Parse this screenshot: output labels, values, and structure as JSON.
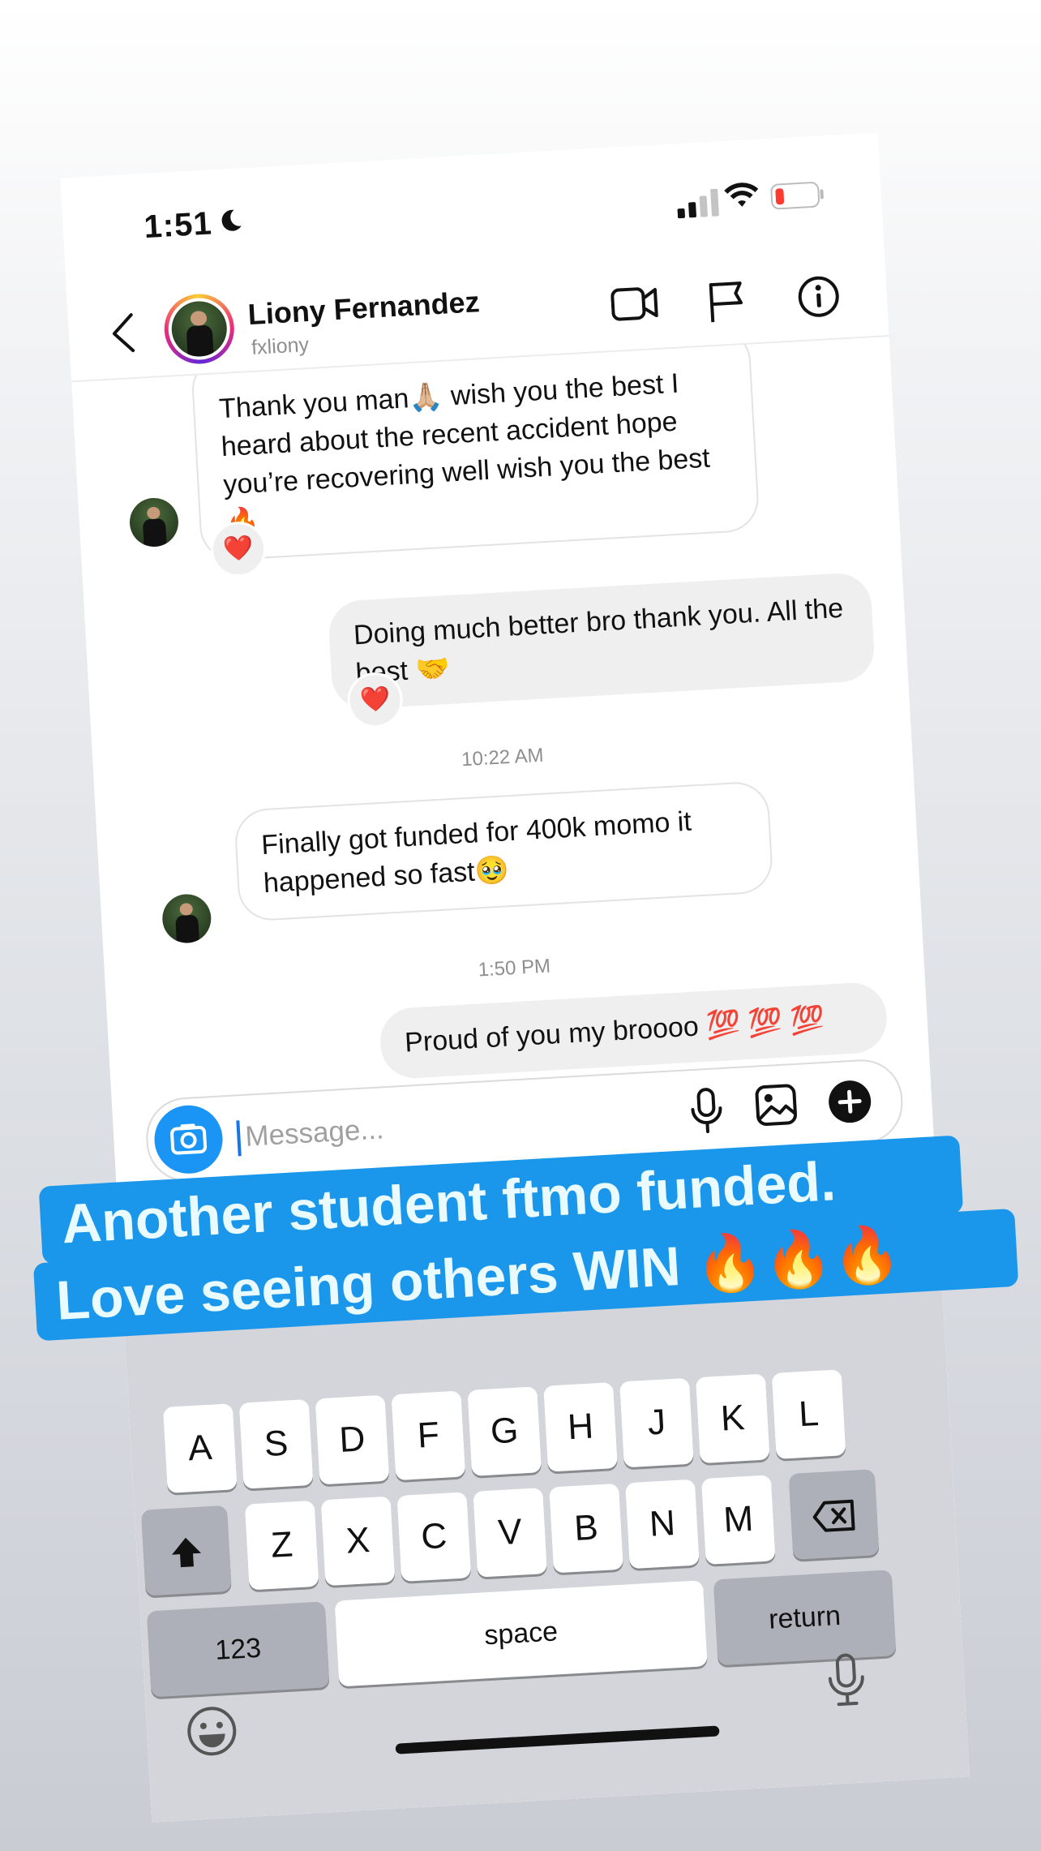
{
  "status": {
    "time": "1:51"
  },
  "header": {
    "name": "Liony Fernandez",
    "handle": "fxliony"
  },
  "messages": [
    {
      "side": "in",
      "text": "Thank you man🙏🏼 wish you the best I heard about the recent accident hope you’re recovering well wish you the best 🔥",
      "reaction": "❤️"
    },
    {
      "side": "out",
      "text": "Doing much better bro thank you. All the best 🤝",
      "reaction": "❤️"
    },
    {
      "timestamp": "10:22 AM"
    },
    {
      "side": "in",
      "text": "Finally got funded for 400k momo it happened so fast🥹"
    },
    {
      "timestamp": "1:50 PM"
    },
    {
      "side": "out",
      "text": "Proud of you my broooo 💯 💯 💯"
    }
  ],
  "composer": {
    "placeholder": "Message..."
  },
  "keyboard": {
    "row2": [
      "A",
      "S",
      "D",
      "F",
      "G",
      "H",
      "J",
      "K",
      "L"
    ],
    "row3": [
      "Z",
      "X",
      "C",
      "V",
      "B",
      "N",
      "M"
    ],
    "numbers": "123",
    "space": "space",
    "return": "return"
  },
  "banner": {
    "line1": "Another student ftmo funded.",
    "line2": "Love seeing others WIN 🔥🔥🔥"
  },
  "colors": {
    "accent": "#1b95f5",
    "banner": "#1a97ea",
    "battery_low": "#ff3b30"
  }
}
